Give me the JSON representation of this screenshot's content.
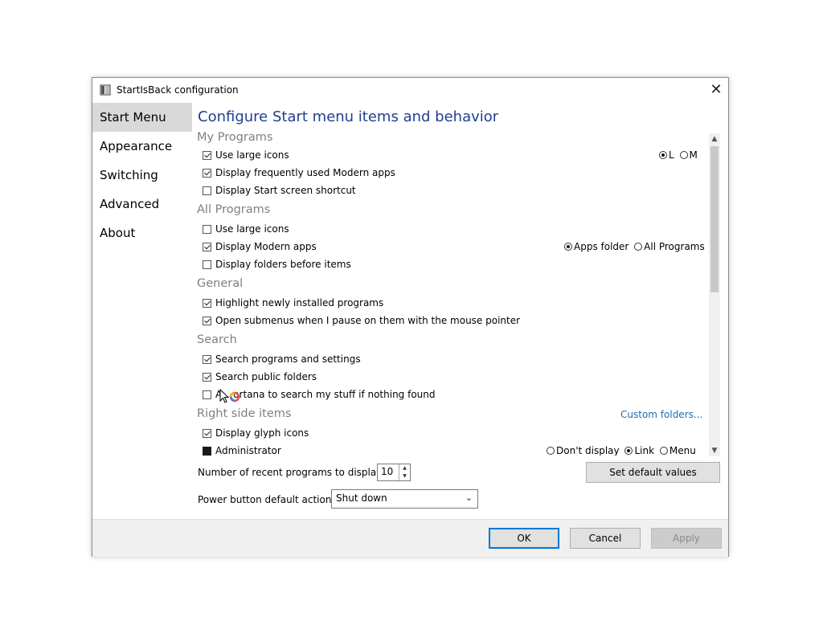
{
  "window": {
    "title": "StartIsBack configuration",
    "close_glyph": "✕"
  },
  "sidebar": {
    "items": [
      {
        "label": "Start Menu",
        "active": true
      },
      {
        "label": "Appearance",
        "active": false
      },
      {
        "label": "Switching",
        "active": false
      },
      {
        "label": "Advanced",
        "active": false
      },
      {
        "label": "About",
        "active": false
      }
    ]
  },
  "main": {
    "heading": "Configure Start menu items and behavior",
    "sections": {
      "my_programs": "My Programs",
      "all_programs": "All Programs",
      "general": "General",
      "search": "Search",
      "right_side": "Right side items"
    },
    "my_programs": {
      "use_large_icons": {
        "label": "Use large icons",
        "checked": true
      },
      "display_modern_apps": {
        "label": "Display frequently used Modern apps",
        "checked": true
      },
      "display_start_shortcut": {
        "label": "Display Start screen shortcut",
        "checked": false
      },
      "size_options": {
        "l": "L",
        "m": "M",
        "selected": "L"
      }
    },
    "all_programs": {
      "use_large_icons": {
        "label": "Use large icons",
        "checked": false
      },
      "display_modern_apps": {
        "label": "Display Modern apps",
        "checked": true
      },
      "display_folders_before": {
        "label": "Display folders before items",
        "checked": false
      },
      "placement": {
        "apps_folder": "Apps folder",
        "all_programs": "All Programs",
        "selected": "Apps folder"
      }
    },
    "general": {
      "highlight_new": {
        "label": "Highlight newly installed programs",
        "checked": true
      },
      "open_submenus": {
        "label": "Open submenus when I pause on them with the mouse pointer",
        "checked": true
      }
    },
    "search": {
      "programs_settings": {
        "label": "Search programs and settings",
        "checked": true
      },
      "public_folders": {
        "label": "Search public folders",
        "checked": true
      },
      "cortana_prefix": "A",
      "cortana_suffix": "ortana to search my stuff if nothing found",
      "cortana_checked": false
    },
    "right_side": {
      "custom_folders": "Custom folders...",
      "glyph_icons": {
        "label": "Display glyph icons",
        "checked": true
      },
      "administrator": {
        "label": "Administrator"
      },
      "admin_options": {
        "dont_display": "Don't display",
        "link": "Link",
        "menu": "Menu",
        "selected": "Link"
      }
    }
  },
  "bottom": {
    "recent_label": "Number of recent programs to display:",
    "recent_value": "10",
    "power_label": "Power button default action:",
    "power_value": "Shut down",
    "set_default": "Set default values"
  },
  "footer": {
    "ok": "OK",
    "cancel": "Cancel",
    "apply": "Apply"
  },
  "colors": {
    "heading": "#1f3f8f",
    "link": "#1a6fb5",
    "accent": "#0078d7"
  }
}
